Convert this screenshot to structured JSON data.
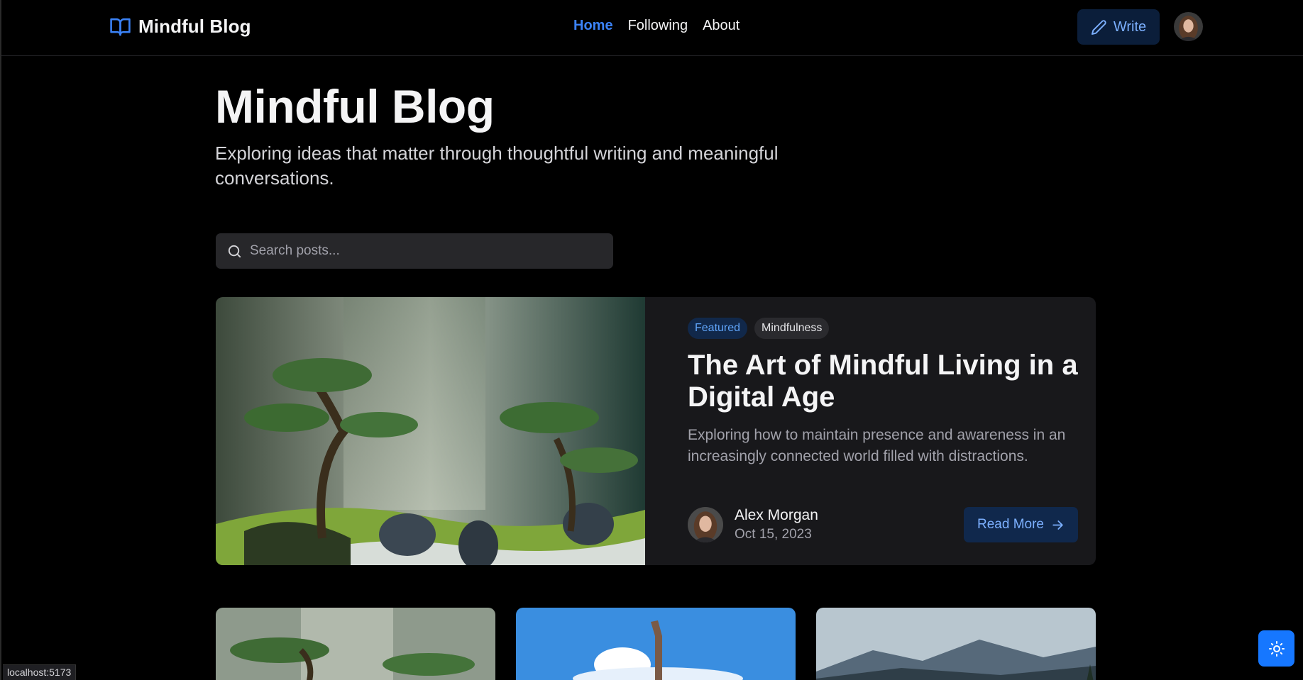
{
  "header": {
    "brand": "Mindful Blog",
    "brand_icon": "book-open-icon",
    "nav": [
      {
        "label": "Home",
        "active": true
      },
      {
        "label": "Following",
        "active": false
      },
      {
        "label": "About",
        "active": false
      }
    ],
    "write_label": "Write",
    "write_icon": "pencil-icon",
    "accent_color": "#3b82f6"
  },
  "hero": {
    "title": "Mindful Blog",
    "subtitle": "Exploring ideas that matter through thoughtful writing and meaningful conversations."
  },
  "search": {
    "placeholder": "Search posts...",
    "value": "",
    "icon": "search-icon"
  },
  "featured": {
    "tags": [
      "Featured",
      "Mindfulness"
    ],
    "title": "The Art of Mindful Living in a Digital Age",
    "excerpt": "Exploring how to maintain presence and awareness in an increasingly connected world filled with distractions.",
    "author": "Alex Morgan",
    "date": "Oct 15, 2023",
    "read_more_label": "Read More",
    "image": "zen-garden-pine-trees"
  },
  "cards": [
    {
      "image": "zen-garden-pine-trees"
    },
    {
      "image": "yoga-pose-sky"
    },
    {
      "image": "mountain-landscape"
    }
  ],
  "theme_toggle_icon": "sun-icon",
  "status_url": "localhost:5173"
}
